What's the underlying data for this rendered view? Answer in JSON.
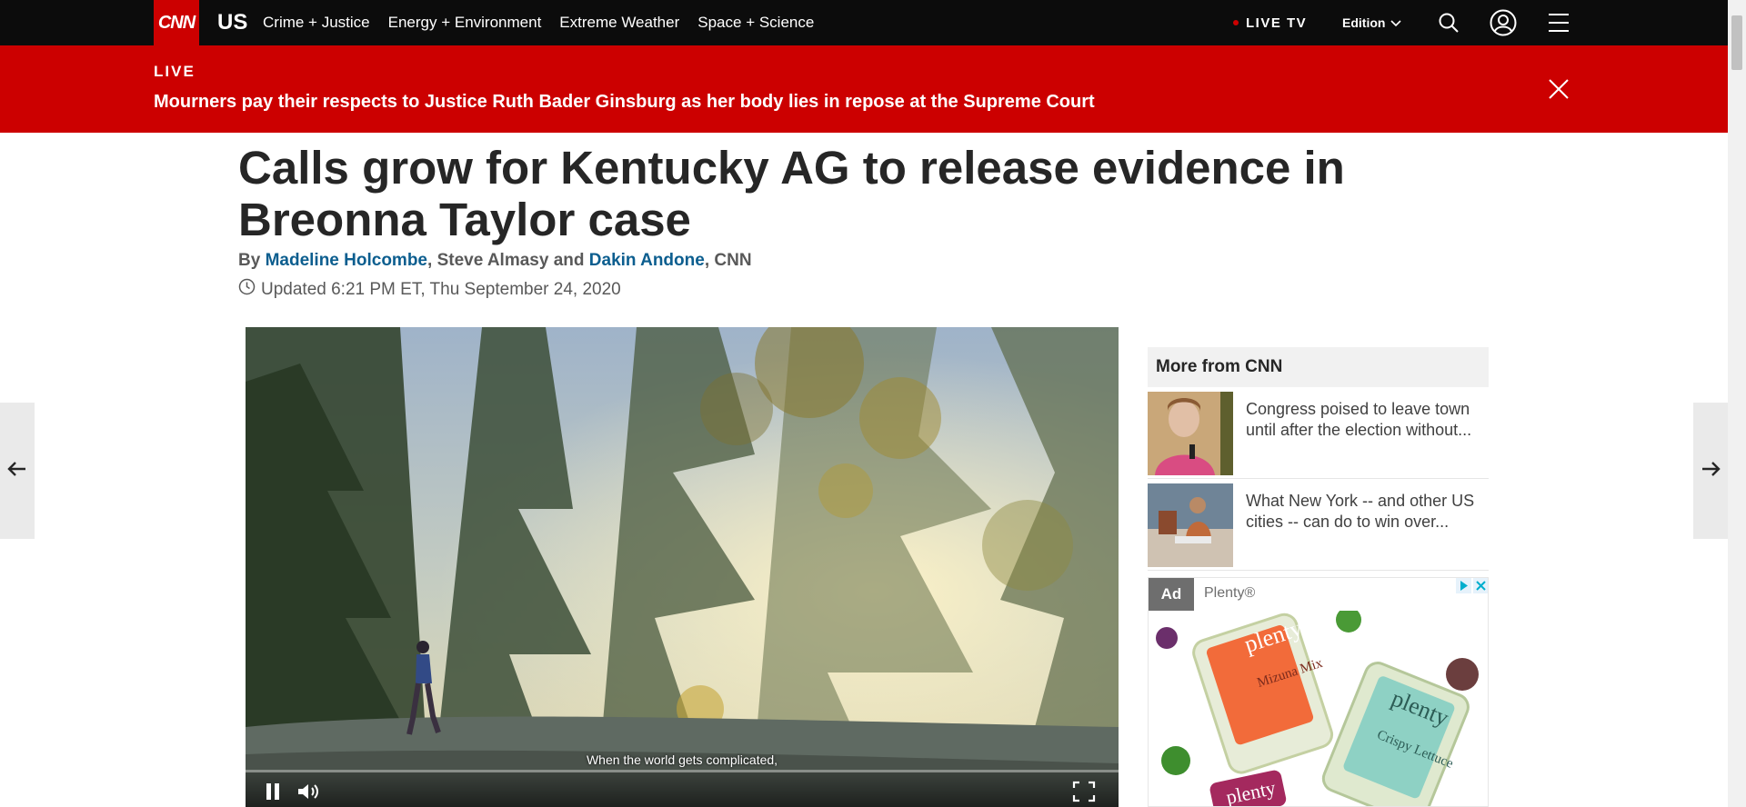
{
  "nav": {
    "logo": "CNN",
    "section": "US",
    "links": [
      "Crime + Justice",
      "Energy + Environment",
      "Extreme Weather",
      "Space + Science"
    ],
    "live_tv": "LIVE TV",
    "edition": "Edition"
  },
  "live_banner": {
    "label": "LIVE",
    "headline": "Mourners pay their respects to Justice Ruth Bader Ginsburg as her body lies in repose at the Supreme Court"
  },
  "article": {
    "headline": "Calls grow for Kentucky AG to release evidence in Breonna Taylor case",
    "byline": {
      "by": "By ",
      "author1": "Madeline Holcombe",
      "sep1": ", ",
      "author2": "Steve Almasy",
      "sep2": " and ",
      "author3": "Dakin Andone",
      "sep3": ", ",
      "outlet": "CNN"
    },
    "updated": "Updated 6:21 PM ET, Thu September 24, 2020"
  },
  "video": {
    "caption": "When the world gets complicated,",
    "progress": 0.0
  },
  "sidebar": {
    "more_title": "More from CNN",
    "items": [
      {
        "title": "Congress poised to leave town until after the election without..."
      },
      {
        "title": "What New York -- and other US cities -- can do to win over..."
      }
    ]
  },
  "ad": {
    "label": "Ad",
    "sponsor": "Plenty®",
    "package_brand": "plenty",
    "product1": "Mizuna Mix",
    "product2": "Crispy Lettuce"
  },
  "colors": {
    "brand_red": "#cc0000",
    "link_blue": "#0c5e8f",
    "nav_bg": "#0c0c0c"
  }
}
